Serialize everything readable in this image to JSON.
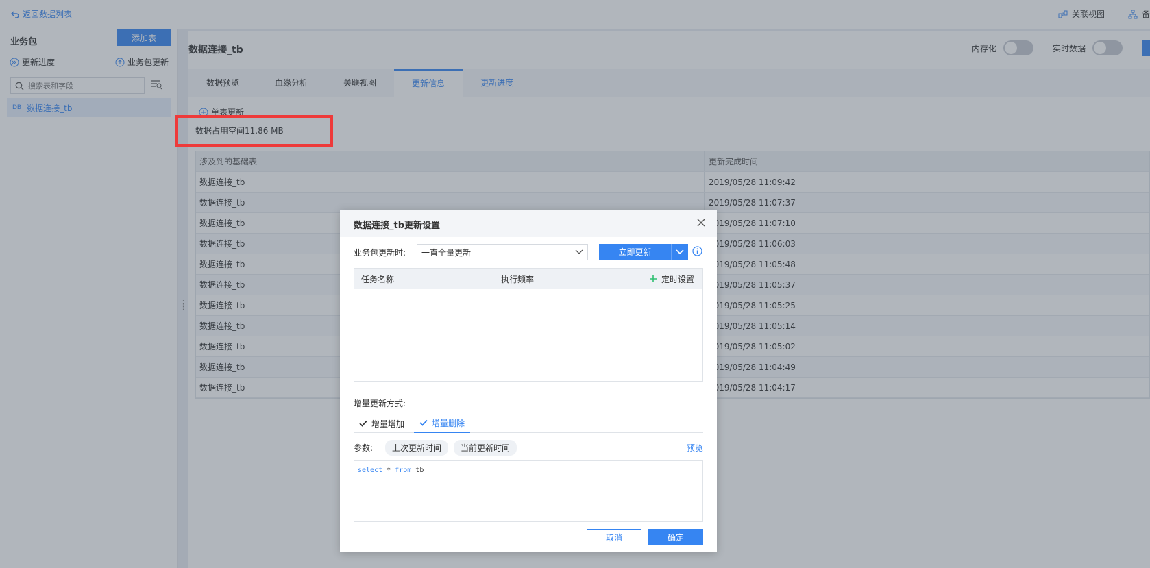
{
  "topbar": {
    "back_label": "返回数据列表",
    "relation_view": "关联视图",
    "more_label": "备"
  },
  "sidebar": {
    "title": "业务包",
    "add_table": "添加表",
    "update_progress": "更新进度",
    "package_update": "业务包更新",
    "search_placeholder": "搜索表和字段",
    "items": [
      {
        "badge": "DB",
        "label": "数据连接_tb"
      }
    ]
  },
  "main": {
    "title": "数据连接_tb",
    "memory_label": "内存化",
    "realtime_label": "实时数据",
    "tabs": [
      {
        "label": "数据预览"
      },
      {
        "label": "血缘分析"
      },
      {
        "label": "关联视图"
      },
      {
        "label": "更新信息"
      },
      {
        "label": "更新进度"
      }
    ],
    "single_update": "单表更新",
    "storage_text": "数据占用空间11.86 MB",
    "table": {
      "headers": [
        "涉及到的基础表",
        "更新完成时间"
      ],
      "rows": [
        [
          "数据连接_tb",
          "2019/05/28 11:09:42"
        ],
        [
          "数据连接_tb",
          "2019/05/28 11:07:37"
        ],
        [
          "数据连接_tb",
          "2019/05/28 11:07:10"
        ],
        [
          "数据连接_tb",
          "2019/05/28 11:06:03"
        ],
        [
          "数据连接_tb",
          "2019/05/28 11:05:48"
        ],
        [
          "数据连接_tb",
          "2019/05/28 11:05:37"
        ],
        [
          "数据连接_tb",
          "2019/05/28 11:05:25"
        ],
        [
          "数据连接_tb",
          "2019/05/28 11:05:14"
        ],
        [
          "数据连接_tb",
          "2019/05/28 11:05:02"
        ],
        [
          "数据连接_tb",
          "2019/05/28 11:04:49"
        ],
        [
          "数据连接_tb",
          "2019/05/28 11:04:17"
        ]
      ]
    }
  },
  "dialog": {
    "title": "数据连接_tb更新设置",
    "update_when_label": "业务包更新时:",
    "update_mode_value": "一直全量更新",
    "update_now": "立即更新",
    "task_table": {
      "col_name": "任务名称",
      "col_freq": "执行频率",
      "add_schedule": "定时设置"
    },
    "incremental_label": "增量更新方式:",
    "inc_tabs": [
      {
        "label": "增量增加"
      },
      {
        "label": "增量删除"
      }
    ],
    "params_label": "参数:",
    "param_chips": [
      "上次更新时间",
      "当前更新时间"
    ],
    "preview": "预览",
    "sql": {
      "kw1": "select",
      "star": " * ",
      "kw2": "from",
      "table": " tb"
    },
    "cancel": "取消",
    "ok": "确定"
  },
  "colors": {
    "accent": "#3685f2",
    "highlight_box": "#ee3a3a",
    "add_green": "#2fbf71"
  }
}
